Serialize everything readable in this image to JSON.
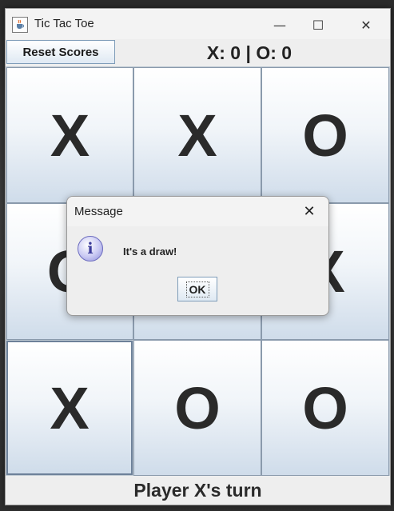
{
  "window": {
    "title": "Tic Tac Toe",
    "minimize_glyph": "—",
    "maximize_glyph": "☐",
    "close_glyph": "✕"
  },
  "toolbar": {
    "reset_label": "Reset Scores",
    "score_text": "X: 0 | O: 0"
  },
  "board": {
    "cells": [
      "X",
      "X",
      "O",
      "O",
      "",
      "X",
      "X",
      "O",
      "O"
    ]
  },
  "status": {
    "text": "Player X's turn"
  },
  "dialog": {
    "title": "Message",
    "close_glyph": "✕",
    "icon_glyph": "i",
    "message": "It's a draw!",
    "ok_label": "OK"
  },
  "icons": {
    "app": "java-cup-icon",
    "dialog": "information-icon"
  }
}
